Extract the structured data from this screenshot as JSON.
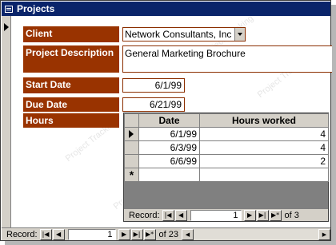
{
  "window": {
    "title": "Projects"
  },
  "watermark_text": "Project Tracking",
  "form": {
    "client": {
      "label": "Client",
      "value": "Network Consultants, Inc"
    },
    "description": {
      "label": "Project Description",
      "value": "General Marketing Brochure"
    },
    "start_date": {
      "label": "Start Date",
      "value": "6/1/99"
    },
    "due_date": {
      "label": "Due Date",
      "value": "6/21/99"
    },
    "hours": {
      "label": "Hours"
    }
  },
  "subform": {
    "columns": [
      "Date",
      "Hours worked"
    ],
    "rows": [
      {
        "date": "6/1/99",
        "hours": "4"
      },
      {
        "date": "6/3/99",
        "hours": "4"
      },
      {
        "date": "6/6/99",
        "hours": "2"
      }
    ],
    "nav": {
      "label": "Record:",
      "current": "1",
      "of_label": "of",
      "total": "3"
    }
  },
  "main_nav": {
    "label": "Record:",
    "current": "1",
    "of_label": "of",
    "total": "23"
  },
  "colors": {
    "label_bg": "#993300",
    "titlebar": "#0a246a"
  }
}
